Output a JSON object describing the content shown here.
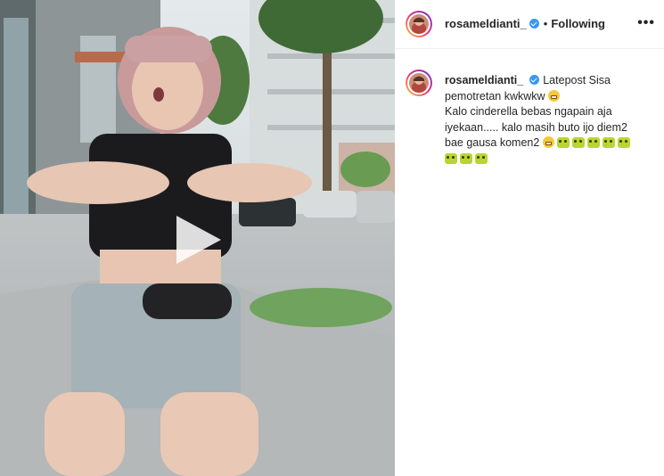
{
  "post": {
    "username": "rosameldianti_",
    "follow_status": "Following",
    "separator": "•",
    "more_label": "•••",
    "caption_lines": [
      "Latepost Sisa",
      "pemotretan kwkwkw",
      "Kalo cinderella bebas ngapain aja",
      "iyekaan..... kalo masih buto ijo diem2",
      "bae gausa komen2"
    ],
    "emojis": {
      "line2": [
        "grinning-squinting-face"
      ],
      "line5": [
        "grinning-squinting-face",
        "face-emoji",
        "face-emoji",
        "face-emoji",
        "face-emoji",
        "face-emoji"
      ],
      "line6": [
        "face-emoji",
        "face-emoji",
        "face-emoji"
      ]
    }
  },
  "colors": {
    "verified": "#3897f0",
    "text": "#262626",
    "story_ring": [
      "#f9ce34",
      "#ee2a7b",
      "#6228d7"
    ]
  },
  "icons": {
    "play": "play-icon",
    "verified": "verified-badge-icon",
    "more": "more-options-icon"
  }
}
